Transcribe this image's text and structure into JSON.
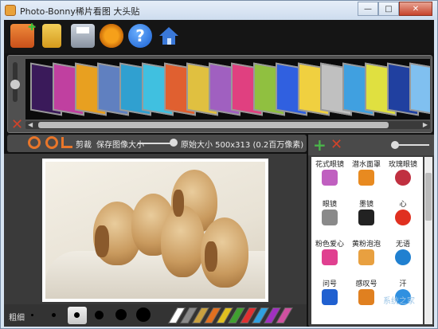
{
  "window": {
    "title": "Photo-Bonny稀片看图 大头贴",
    "controls": [
      "minimize",
      "maximize",
      "close"
    ]
  },
  "toolbar": {
    "buttons": [
      {
        "name": "add-photo",
        "icon": "photo-plus-icon"
      },
      {
        "name": "open",
        "icon": "folder-icon"
      },
      {
        "name": "save",
        "icon": "disk-icon"
      },
      {
        "name": "settings",
        "icon": "gear-icon"
      },
      {
        "name": "help",
        "icon": "help-icon",
        "glyph": "?"
      },
      {
        "name": "home",
        "icon": "home-icon"
      }
    ]
  },
  "edit": {
    "crop_label": "剪裁",
    "save_size_label": "保存图像大小",
    "original_size_label": "原始大小 500x313 (0.2百万像素)"
  },
  "brush": {
    "label": "粗细"
  },
  "stickers": [
    {
      "name": "花式眼镜",
      "color": "#c060c0"
    },
    {
      "name": "潜水面罩",
      "color": "#e88a20"
    },
    {
      "name": "玫瑰眼镜",
      "color": "#c03040"
    },
    {
      "name": "眼镜",
      "color": "#8a8a8a"
    },
    {
      "name": "墨镜",
      "color": "#222222"
    },
    {
      "name": "心",
      "color": "#e03020"
    },
    {
      "name": "粉色爱心",
      "color": "#e04090"
    },
    {
      "name": "黄粉泡泡",
      "color": "#e8a040"
    },
    {
      "name": "无语",
      "color": "#2080d0"
    },
    {
      "name": "问号",
      "color": "#2060d0"
    },
    {
      "name": "感叹号",
      "color": "#e08020"
    },
    {
      "name": "汗",
      "color": "#3090e0"
    }
  ],
  "strip_colors": [
    "#3a1a5a",
    "#c040a0",
    "#e8a020",
    "#6080c0",
    "#30a0d0",
    "#40c0e0",
    "#e06030",
    "#e0c040",
    "#a060c0",
    "#e04080",
    "#90c040",
    "#3060e0",
    "#f0d040",
    "#c0c0c0",
    "#40a0e0",
    "#e0e040",
    "#2040a0",
    "#80c0f0"
  ],
  "pen_colors": [
    "#ffffff",
    "#8a8a8a",
    "#c8a040",
    "#e07020",
    "#e0c020",
    "#40a030",
    "#e03030",
    "#30a0e0",
    "#a030c0",
    "#d050a0"
  ],
  "watermark": "系统之家"
}
